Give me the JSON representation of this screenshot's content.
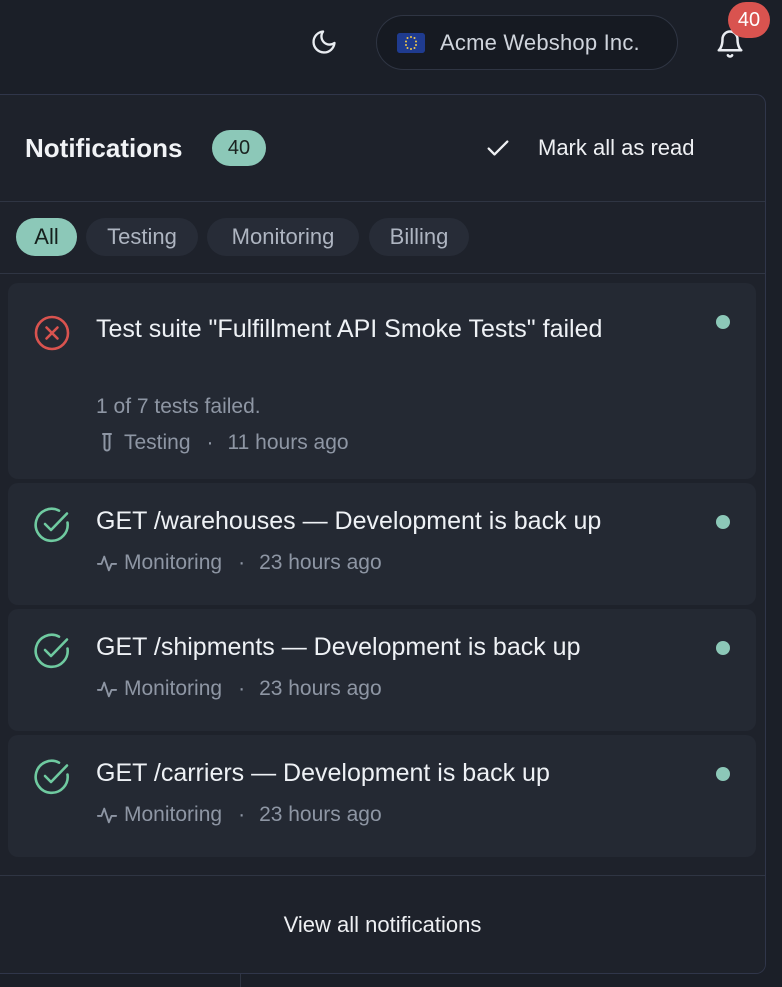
{
  "topbar": {
    "org_name": "Acme Webshop Inc.",
    "flag_icon": "eu-flag-icon",
    "theme_icon": "moon-icon",
    "bell_icon": "bell-icon",
    "bell_badge": "40"
  },
  "panel": {
    "title": "Notifications",
    "count": "40",
    "mark_all_label": "Mark all as read",
    "filters": [
      "All",
      "Testing",
      "Monitoring",
      "Billing"
    ],
    "active_filter": "All",
    "footer_label": "View all notifications"
  },
  "notifications": [
    {
      "status": "error",
      "title": "Test suite \"Fulfillment API Smoke Tests\" failed",
      "subtitle": "1 of 7 tests failed.",
      "category": "Testing",
      "category_icon": "test-tube-icon",
      "separator": "·",
      "time": "11 hours ago",
      "unread": true
    },
    {
      "status": "success",
      "title": "GET /warehouses — Development is back up",
      "category": "Monitoring",
      "category_icon": "pulse-icon",
      "separator": "·",
      "time": "23 hours ago",
      "unread": true
    },
    {
      "status": "success",
      "title": "GET /shipments — Development is back up",
      "category": "Monitoring",
      "category_icon": "pulse-icon",
      "separator": "·",
      "time": "23 hours ago",
      "unread": true
    },
    {
      "status": "success",
      "title": "GET /carriers — Development is back up",
      "category": "Monitoring",
      "category_icon": "pulse-icon",
      "separator": "·",
      "time": "23 hours ago",
      "unread": true
    }
  ],
  "colors": {
    "accent": "#8cc8b8",
    "error": "#d9534f",
    "success": "#6fcaa0",
    "background": "#1b1f28"
  }
}
